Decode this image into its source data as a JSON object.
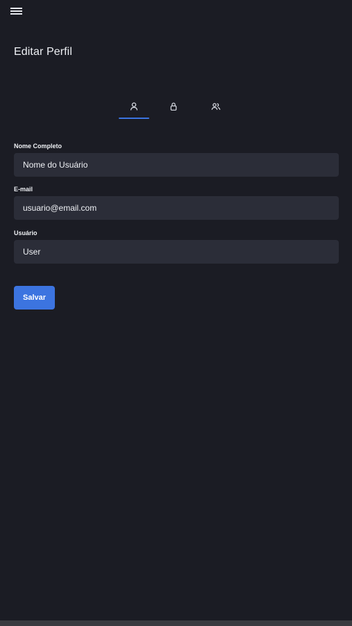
{
  "header": {
    "title": "Editar Perfil"
  },
  "tabs": [
    {
      "icon": "user-icon",
      "active": true
    },
    {
      "icon": "lock-icon",
      "active": false
    },
    {
      "icon": "users-icon",
      "active": false
    }
  ],
  "form": {
    "full_name": {
      "label": "Nome Completo",
      "value": "Nome do Usuário"
    },
    "email": {
      "label": "E-mail",
      "value": "usuario@email.com"
    },
    "username": {
      "label": "Usuário",
      "value": "User"
    },
    "save_label": "Salvar"
  },
  "colors": {
    "background": "#1b1c24",
    "input_background": "#2b2d38",
    "accent": "#3c74e0",
    "text": "#eef0f4"
  }
}
